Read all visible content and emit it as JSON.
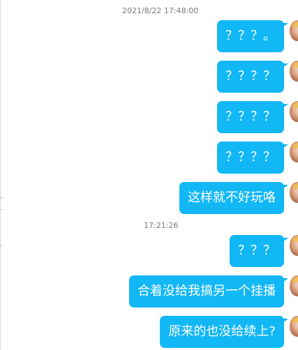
{
  "timestamps": [
    {
      "text": "2021/8/22 17:48:00"
    },
    {
      "text": "17:21:26"
    }
  ],
  "messages": [
    {
      "text": "？？？。",
      "sender": "self"
    },
    {
      "text": "？？？？",
      "sender": "self"
    },
    {
      "text": "？？？？",
      "sender": "self"
    },
    {
      "text": "？？？？",
      "sender": "self"
    },
    {
      "text": "这样就不好玩咯",
      "sender": "self"
    },
    {
      "text": "？？？",
      "sender": "self"
    },
    {
      "text": "合着没给我搞另一个挂播",
      "sender": "self"
    },
    {
      "text": "原来的也没给续上?",
      "sender": "self"
    }
  ],
  "colors": {
    "bubble": "#12b7f5",
    "bubble_text": "#ffffff",
    "timestamp": "#7a7a7a",
    "background": "#ffffff"
  },
  "icons": {
    "avatar": "user-avatar-icon"
  }
}
